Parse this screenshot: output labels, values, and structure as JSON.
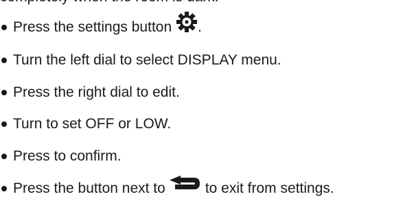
{
  "intro": {
    "text": "completely when the room is dark."
  },
  "steps": [
    {
      "text": "Press the settings button",
      "icon": "gear-icon",
      "after_icon": "."
    },
    {
      "text": "Turn the left dial to select DISPLAY menu."
    },
    {
      "text": "Press the right dial to edit."
    },
    {
      "text": "Turn to set OFF or LOW."
    },
    {
      "text": "Press to confirm."
    },
    {
      "text": "Press the button next to",
      "icon": "back-arrow-icon",
      "after_icon": "to exit from settings."
    }
  ],
  "colors": {
    "text": "#1a1a1a",
    "background": "#ffffff"
  }
}
